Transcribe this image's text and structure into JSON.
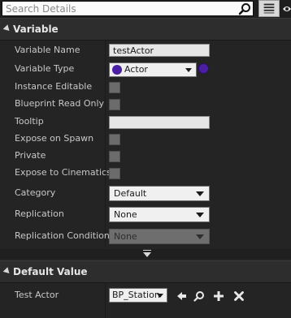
{
  "search": {
    "placeholder": "Search Details"
  },
  "variable_section": {
    "title": "Variable",
    "variable_name": {
      "label": "Variable Name",
      "value": "testActor"
    },
    "variable_type": {
      "label": "Variable Type",
      "value": "Actor"
    },
    "instance_editable": {
      "label": "Instance Editable",
      "checked": false
    },
    "blueprint_read_only": {
      "label": "Blueprint Read Only",
      "checked": false
    },
    "tooltip": {
      "label": "Tooltip",
      "value": ""
    },
    "expose_on_spawn": {
      "label": "Expose on Spawn",
      "checked": false
    },
    "private": {
      "label": "Private",
      "checked": false
    },
    "expose_to_cinematics": {
      "label": "Expose to Cinematics",
      "checked": false
    },
    "category": {
      "label": "Category",
      "value": "Default"
    },
    "replication": {
      "label": "Replication",
      "value": "None"
    },
    "replication_condition": {
      "label": "Replication Condition",
      "value": "None"
    }
  },
  "default_value_section": {
    "title": "Default Value",
    "test_actor": {
      "label": "Test Actor",
      "value": "BP_Station"
    }
  },
  "colors": {
    "type_pill": "#4b1fa3",
    "panel_bg": "#242424",
    "header_bg": "#2d2d2d"
  }
}
